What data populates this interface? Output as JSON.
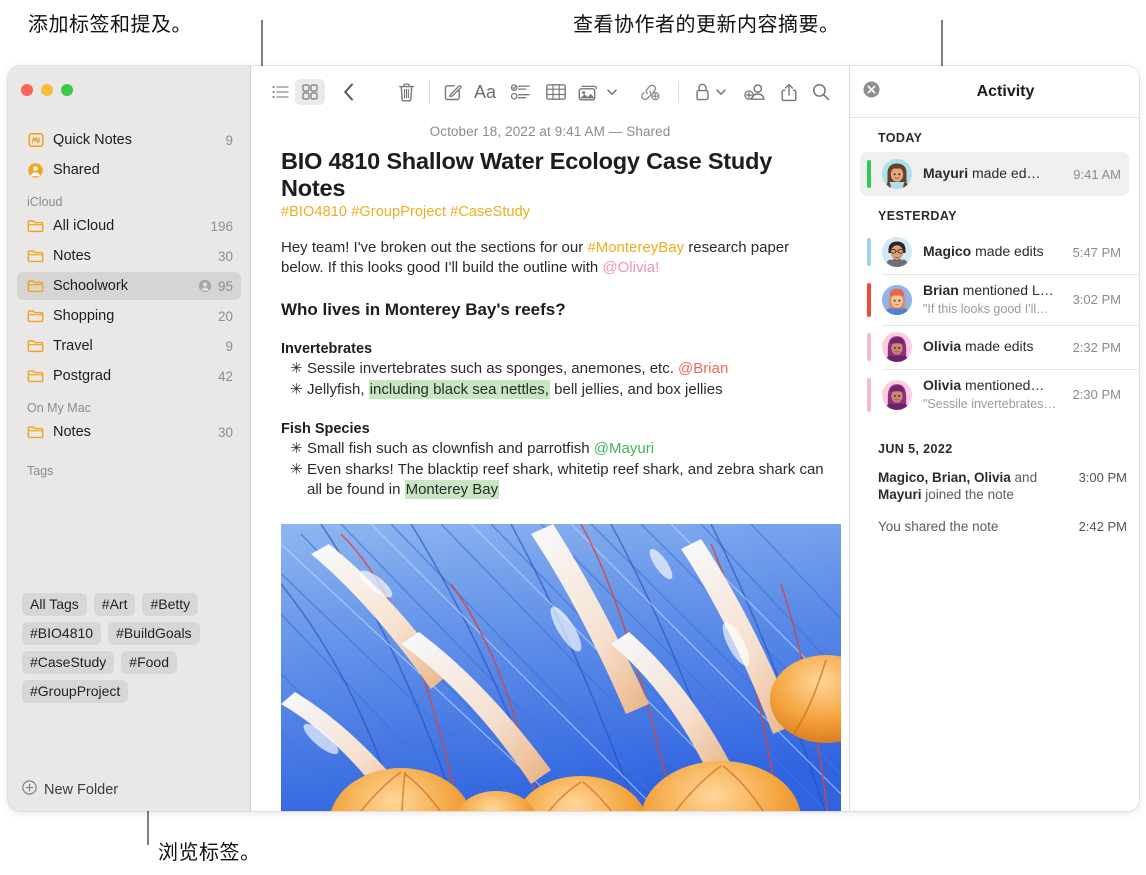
{
  "callouts": {
    "top_left": "添加标签和提及。",
    "top_right": "查看协作者的更新内容摘要。",
    "bottom": "浏览标签。"
  },
  "sidebar": {
    "top_items": [
      {
        "label": "Quick Notes",
        "count": "9",
        "icon": "quick-note-icon"
      },
      {
        "label": "Shared",
        "count": "",
        "icon": "shared-person-icon"
      }
    ],
    "sections": [
      {
        "header": "iCloud",
        "items": [
          {
            "label": "All iCloud",
            "count": "196",
            "shared": false
          },
          {
            "label": "Notes",
            "count": "30",
            "shared": false
          },
          {
            "label": "Schoolwork",
            "count": "95",
            "shared": true,
            "selected": true
          },
          {
            "label": "Shopping",
            "count": "20",
            "shared": false
          },
          {
            "label": "Travel",
            "count": "9",
            "shared": false
          },
          {
            "label": "Postgrad",
            "count": "42",
            "shared": false
          }
        ]
      },
      {
        "header": "On My Mac",
        "items": [
          {
            "label": "Notes",
            "count": "30",
            "shared": false
          }
        ]
      }
    ],
    "tags_header": "Tags",
    "tags": [
      "All Tags",
      "#Art",
      "#Betty",
      "#BIO4810",
      "#BuildGoals",
      "#CaseStudy",
      "#Food",
      "#GroupProject"
    ],
    "new_folder": "New Folder"
  },
  "toolbar": {
    "buttons": [
      {
        "name": "list-view-icon",
        "label": "List View"
      },
      {
        "name": "gallery-view-icon",
        "label": "Gallery View"
      },
      {
        "name": "back-chevron-icon",
        "label": "Back"
      },
      {
        "name": "trash-icon",
        "label": "Delete"
      },
      {
        "name": "compose-icon",
        "label": "New Note"
      },
      {
        "name": "format-aa-icon",
        "label": "Aa"
      },
      {
        "name": "checklist-icon",
        "label": "Checklist"
      },
      {
        "name": "table-icon",
        "label": "Table"
      },
      {
        "name": "media-icon",
        "label": "Media"
      },
      {
        "name": "link-add-icon",
        "label": "Add Link"
      },
      {
        "name": "lock-icon",
        "label": "Lock"
      },
      {
        "name": "add-person-icon",
        "label": "Share Note"
      },
      {
        "name": "share-icon",
        "label": "Share"
      },
      {
        "name": "search-icon",
        "label": "Search"
      }
    ],
    "aa_label": "Aa"
  },
  "note": {
    "date_line": "October 18, 2022 at 9:41 AM — Shared",
    "title": "BIO 4810 Shallow Water Ecology Case Study Notes",
    "tags_line": "#BIO4810 #GroupProject #CaseStudy",
    "intro": {
      "part1": "Hey team! I've broken out the sections for our ",
      "hashtag": "#MontereyBay",
      "part2": " research paper below. If this looks good I'll build the outline with ",
      "mention": "@Olivia!"
    },
    "heading": "Who lives in Monterey Bay's reefs?",
    "sections": [
      {
        "subheading": "Invertebrates",
        "bullets": [
          {
            "text": "Sessile invertebrates such as sponges, anemones, etc. ",
            "mention": "@Brian",
            "mention_color": "red"
          },
          {
            "pre": "Jellyfish, ",
            "highlight": "including black sea nettles,",
            "post": " bell jellies, and box jellies"
          }
        ]
      },
      {
        "subheading": "Fish Species",
        "bullets": [
          {
            "text": "Small fish such as clownfish and parrotfish ",
            "mention": "@Mayuri",
            "mention_color": "green"
          },
          {
            "pre": "Even sharks! The blacktip reef shark, whitetip reef shark, and zebra shark can all be found in ",
            "highlight": "Monterey Bay",
            "post": ""
          }
        ]
      }
    ],
    "image_alt": "jellyfish-photo"
  },
  "activity": {
    "title": "Activity",
    "close_label": "Close",
    "groups": [
      {
        "label": "TODAY",
        "items": [
          {
            "name": "Mayuri",
            "action": " made ed…",
            "quote": "",
            "time": "9:41 AM",
            "bar_color": "#35c759",
            "avatar_bg": "#a9e2ec",
            "avatar_hair": "#7b4a2d",
            "avatar_skin": "#e8b68c",
            "selected": true
          }
        ]
      },
      {
        "label": "YESTERDAY",
        "items": [
          {
            "name": "Magico",
            "action": " made edits",
            "quote": "",
            "time": "5:47 PM",
            "bar_color": "#9ed3ec",
            "avatar_bg": "#cfe9f6",
            "avatar_hair": "#3b2a22",
            "avatar_skin": "#d9a273",
            "selected": false
          },
          {
            "name": "Brian",
            "action": " mentioned L…",
            "quote": "\"If this looks good I'll…",
            "time": "3:02 PM",
            "bar_color": "#f04a3c",
            "avatar_bg": "#8fb4ee",
            "avatar_hair": "#c86a4a",
            "avatar_skin": "#f0c39c",
            "selected": false
          },
          {
            "name": "Olivia",
            "action": " made edits",
            "quote": "",
            "time": "2:32 PM",
            "bar_color": "#f7b9cd",
            "avatar_bg": "#f9cfe0",
            "avatar_hair": "#8e2f86",
            "avatar_skin": "#c98a6b",
            "selected": false
          },
          {
            "name": "Olivia",
            "action": " mentioned…",
            "quote": "\"Sessile invertebrates…",
            "time": "2:30 PM",
            "bar_color": "#f7b9cd",
            "avatar_bg": "#f9cfe0",
            "avatar_hair": "#8e2f86",
            "avatar_skin": "#c98a6b",
            "selected": false
          }
        ]
      }
    ],
    "footer": {
      "label": "JUN 5, 2022",
      "rows": [
        {
          "names": "Magico, Brian, Olivia",
          "mid": " and ",
          "names2": "Mayuri",
          "tail": " joined the note",
          "time": "3:00 PM"
        },
        {
          "plain": "You shared the note",
          "time": "2:42 PM"
        }
      ]
    }
  },
  "colors": {
    "accent_orange": "#f0ac20",
    "sidebar_bg": "#e9e8e7",
    "selection": "#d6d5d4",
    "highlight_green": "#c8e6c2"
  }
}
